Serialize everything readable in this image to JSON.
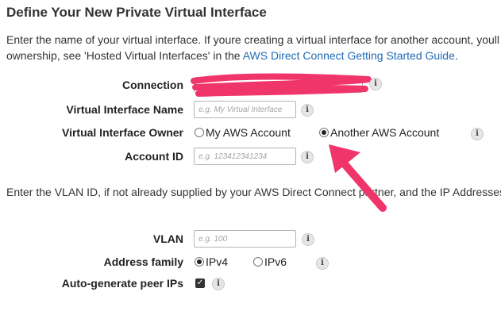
{
  "title": "Define Your New Private Virtual Interface",
  "intro": {
    "line1": "Enter the name of your virtual interface. If youre creating a virtual interface for another account, youll",
    "line2_prefix": "ownership, see 'Hosted Virtual Interfaces' in the ",
    "line2_link": "AWS Direct Connect Getting Started Guide",
    "line2_suffix": "."
  },
  "form": {
    "connection_label": "Connection",
    "vif_name_label": "Virtual Interface Name",
    "vif_name_placeholder": "e.g. My Virtual Interface",
    "owner_label": "Virtual Interface Owner",
    "owner_option_mine": "My AWS Account",
    "owner_option_other": "Another AWS Account",
    "owner_selected": "Another AWS Account",
    "account_id_label": "Account ID",
    "account_id_placeholder": "e.g. 123412341234"
  },
  "vlan_intro": "Enter the VLAN ID, if not already supplied by your AWS Direct Connect partner, and the IP Addresses",
  "network": {
    "vlan_label": "VLAN",
    "vlan_placeholder": "e.g. 100",
    "family_label": "Address family",
    "family_ipv4": "IPv4",
    "family_ipv6": "IPv6",
    "family_selected": "IPv4",
    "autogen_label": "Auto-generate peer IPs",
    "autogen_checked": true
  },
  "info_glyph": "i",
  "check_glyph": "✓",
  "colors": {
    "link": "#1f6bb5",
    "annotation": "#f0356b"
  },
  "icons": {
    "info": "info-icon",
    "annotation_arrow": "annotation-arrow-icon",
    "redaction": "redaction-scribble"
  }
}
